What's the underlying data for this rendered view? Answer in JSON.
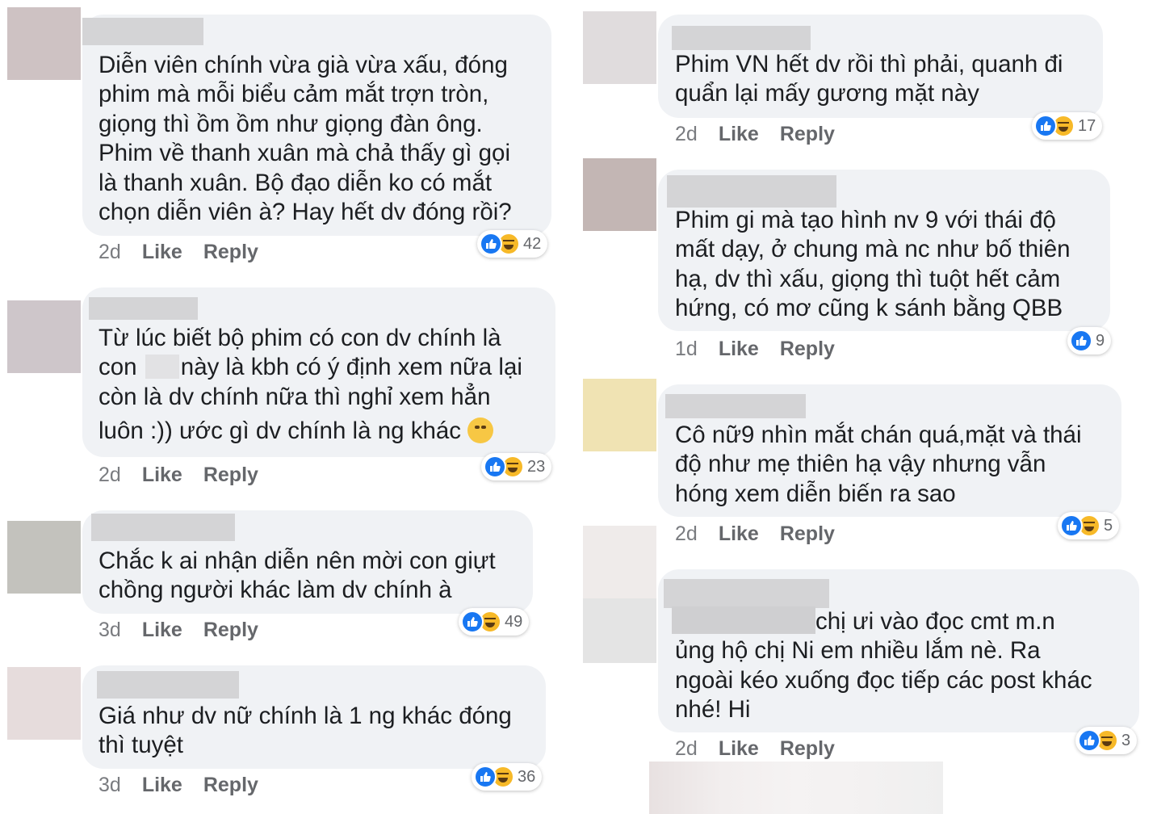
{
  "left_column": [
    {
      "lines": [
        "Diễn viên chính vừa già vừa xấu, đóng",
        "phim mà mỗi biểu cảm mắt trợn tròn,",
        "giọng thì ồm ồm như giọng đàn ông.",
        "Phim về thanh xuân mà chả thấy gì gọi",
        "là thanh xuân. Bộ đạo diễn ko có mắt",
        "chọn diễn viên à? Hay hết dv đóng rồi?"
      ],
      "time": "2d",
      "like": "Like",
      "reply": "Reply",
      "reactions": [
        "like",
        "haha"
      ],
      "count": "42"
    },
    {
      "line1": "Từ lúc biết bộ phim có con dv chính là",
      "line2_pre": "con",
      "line2_post": "này là kbh có ý định xem nữa lại",
      "line3": "còn là dv chính nữa thì nghỉ xem hẳn",
      "line4": "luôn :)) ước gì dv chính là ng khác",
      "time": "2d",
      "like": "Like",
      "reply": "Reply",
      "reactions": [
        "like",
        "haha"
      ],
      "count": "23"
    },
    {
      "lines": [
        "Chắc k ai nhận diễn nên mời con giựt",
        "chồng người khác làm dv chính à"
      ],
      "time": "3d",
      "like": "Like",
      "reply": "Reply",
      "reactions": [
        "like",
        "haha"
      ],
      "count": "49"
    },
    {
      "lines": [
        "Giá như dv nữ chính là 1 ng khác đóng",
        "thì tuyệt"
      ],
      "time": "3d",
      "like": "Like",
      "reply": "Reply",
      "reactions": [
        "like",
        "haha"
      ],
      "count": "36"
    }
  ],
  "right_column": [
    {
      "lines": [
        "Phim VN hết dv rồi thì phải, quanh đi",
        "quẩn lại mấy gương mặt này"
      ],
      "time": "2d",
      "like": "Like",
      "reply": "Reply",
      "reactions": [
        "like",
        "haha"
      ],
      "count": "17"
    },
    {
      "lines": [
        "Phim gi mà tạo hình nv 9 với thái độ",
        "mất dạy, ở chung mà nc như bố thiên",
        "hạ, dv thì xấu, giọng thì tuột hết cảm",
        "hứng, có mơ cũng k sánh bằng QBB"
      ],
      "time": "1d",
      "like": "Like",
      "reply": "Reply",
      "reactions": [
        "like"
      ],
      "count": "9"
    },
    {
      "lines": [
        "Cô nữ9 nhìn mắt chán quá,mặt và thái",
        "độ như mẹ thiên hạ vậy nhưng vẫn",
        "hóng xem diễn biến ra sao"
      ],
      "time": "2d",
      "like": "Like",
      "reply": "Reply",
      "reactions": [
        "like",
        "haha"
      ],
      "count": "5"
    },
    {
      "line1_post": "chị ưi vào đọc cmt m.n",
      "lines": [
        "ủng hộ chị Ni em nhiều lắm nè. Ra",
        "ngoài kéo xuống đọc tiếp các post khác",
        "nhé! Hi"
      ],
      "time": "2d",
      "like": "Like",
      "reply": "Reply",
      "reactions": [
        "like",
        "haha"
      ],
      "count": "3"
    }
  ],
  "colors": {
    "bubble": "#f0f2f5",
    "like_blue": "#1877f2",
    "haha_yellow": "#f7b928",
    "meta_gray": "#65676b"
  }
}
